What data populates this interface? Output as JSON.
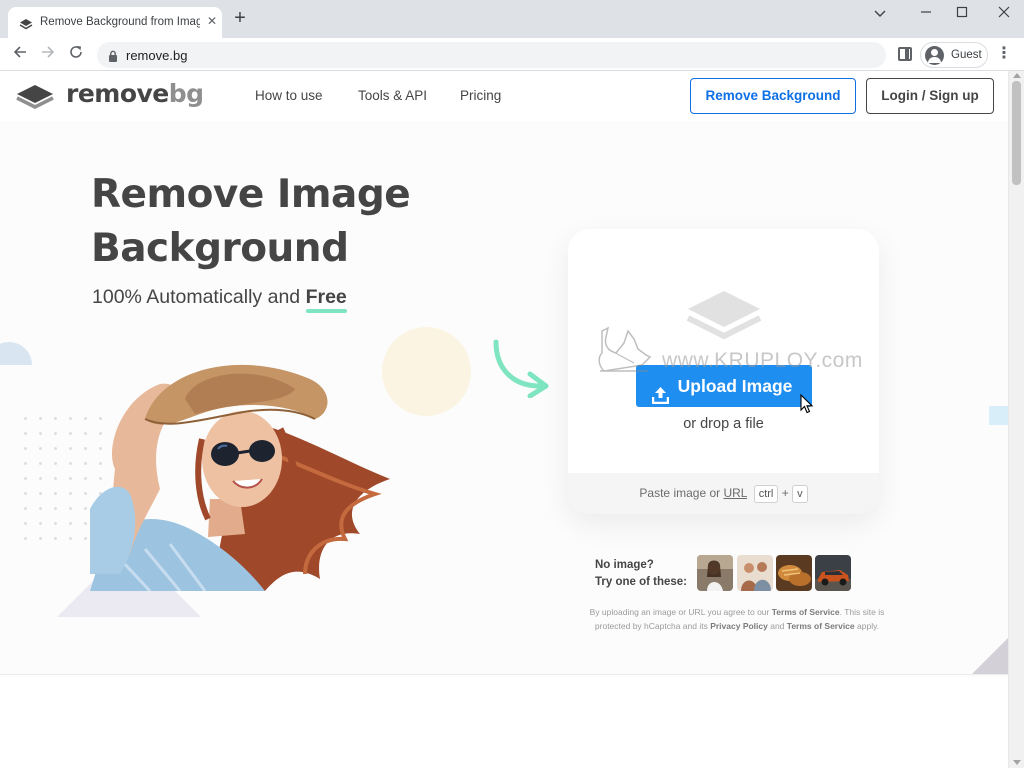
{
  "browser": {
    "tab_title": "Remove Background from Image",
    "tab_close": "✕",
    "new_tab": "+",
    "url": "remove.bg",
    "profile_label": "Guest",
    "window_controls": {
      "minimize": "—",
      "maximize": "☐",
      "close": "✕",
      "tab_search": "⌄"
    }
  },
  "nav": {
    "logo_remove": "remove",
    "logo_bg": "bg",
    "links": [
      "How to use",
      "Tools & API",
      "Pricing"
    ],
    "cta_remove": "Remove Background",
    "cta_login": "Login / Sign up"
  },
  "hero": {
    "title_line1": "Remove Image",
    "title_line2": "Background",
    "subtitle_prefix": "100% Automatically and ",
    "subtitle_free": "Free"
  },
  "upload": {
    "button_label": "Upload Image",
    "drop_text": "or drop a file",
    "paste_prefix": "Paste image or ",
    "paste_url": "URL",
    "key_ctrl": "ctrl",
    "key_plus": "+",
    "key_v": "v"
  },
  "watermark": "www.KRUPLOY.com",
  "samples": {
    "line1": "No image?",
    "line2": "Try one of these:"
  },
  "legal": {
    "part1": "By uploading an image or URL you agree to our ",
    "terms1": "Terms of Service",
    "part2": ". This site is protected by hCaptcha and its ",
    "privacy": "Privacy Policy",
    "part3": " and ",
    "terms2": "Terms of Service",
    "part4": " apply."
  },
  "colors": {
    "brand_blue": "#1f8ef1",
    "link_blue": "#0f70e6",
    "text_dark": "#454545",
    "accent_green": "#7fe5c1"
  }
}
